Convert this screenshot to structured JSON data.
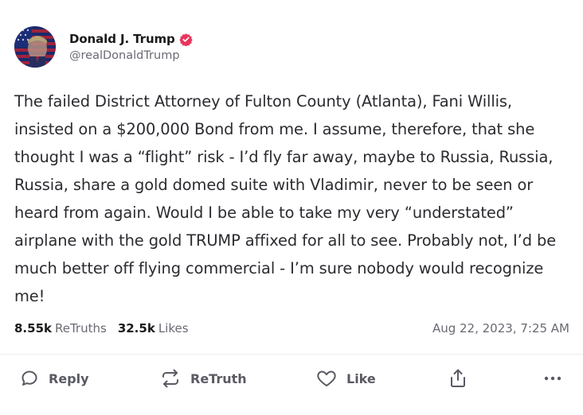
{
  "author": {
    "display_name": "Donald J. Trump",
    "handle": "@realDonaldTrump",
    "verified_icon": "verified-badge-icon",
    "verified_color": "#e8355b"
  },
  "post": {
    "text": "The failed District Attorney of Fulton County (Atlanta), Fani Willis, insisted on a $200,000 Bond from me. I assume, therefore, that she thought I was a “flight” risk - I’d fly far away, maybe to Russia, Russia, Russia, share a gold domed suite with Vladimir, never to be seen or heard from again. Would I be able to take my very “understated” airplane with the gold TRUMP affixed for all to see. Probably not, I’d be much better off flying commercial - I’m sure nobody would recognize me!",
    "timestamp": "Aug 22, 2023, 7:25 AM"
  },
  "stats": {
    "retruths_count": "8.55k",
    "retruths_label": "ReTruths",
    "likes_count": "32.5k",
    "likes_label": "Likes"
  },
  "actions": {
    "reply": {
      "label": "Reply",
      "icon": "speech-bubble-icon"
    },
    "retruth": {
      "label": "ReTruth",
      "icon": "repost-arrows-icon"
    },
    "like": {
      "label": "Like",
      "icon": "heart-icon"
    },
    "share": {
      "icon": "share-upload-icon"
    },
    "more": {
      "icon": "more-dots-icon"
    }
  },
  "colors": {
    "text_primary": "#1a1a1a",
    "text_secondary": "#6a6a73",
    "divider": "#ececf0"
  }
}
